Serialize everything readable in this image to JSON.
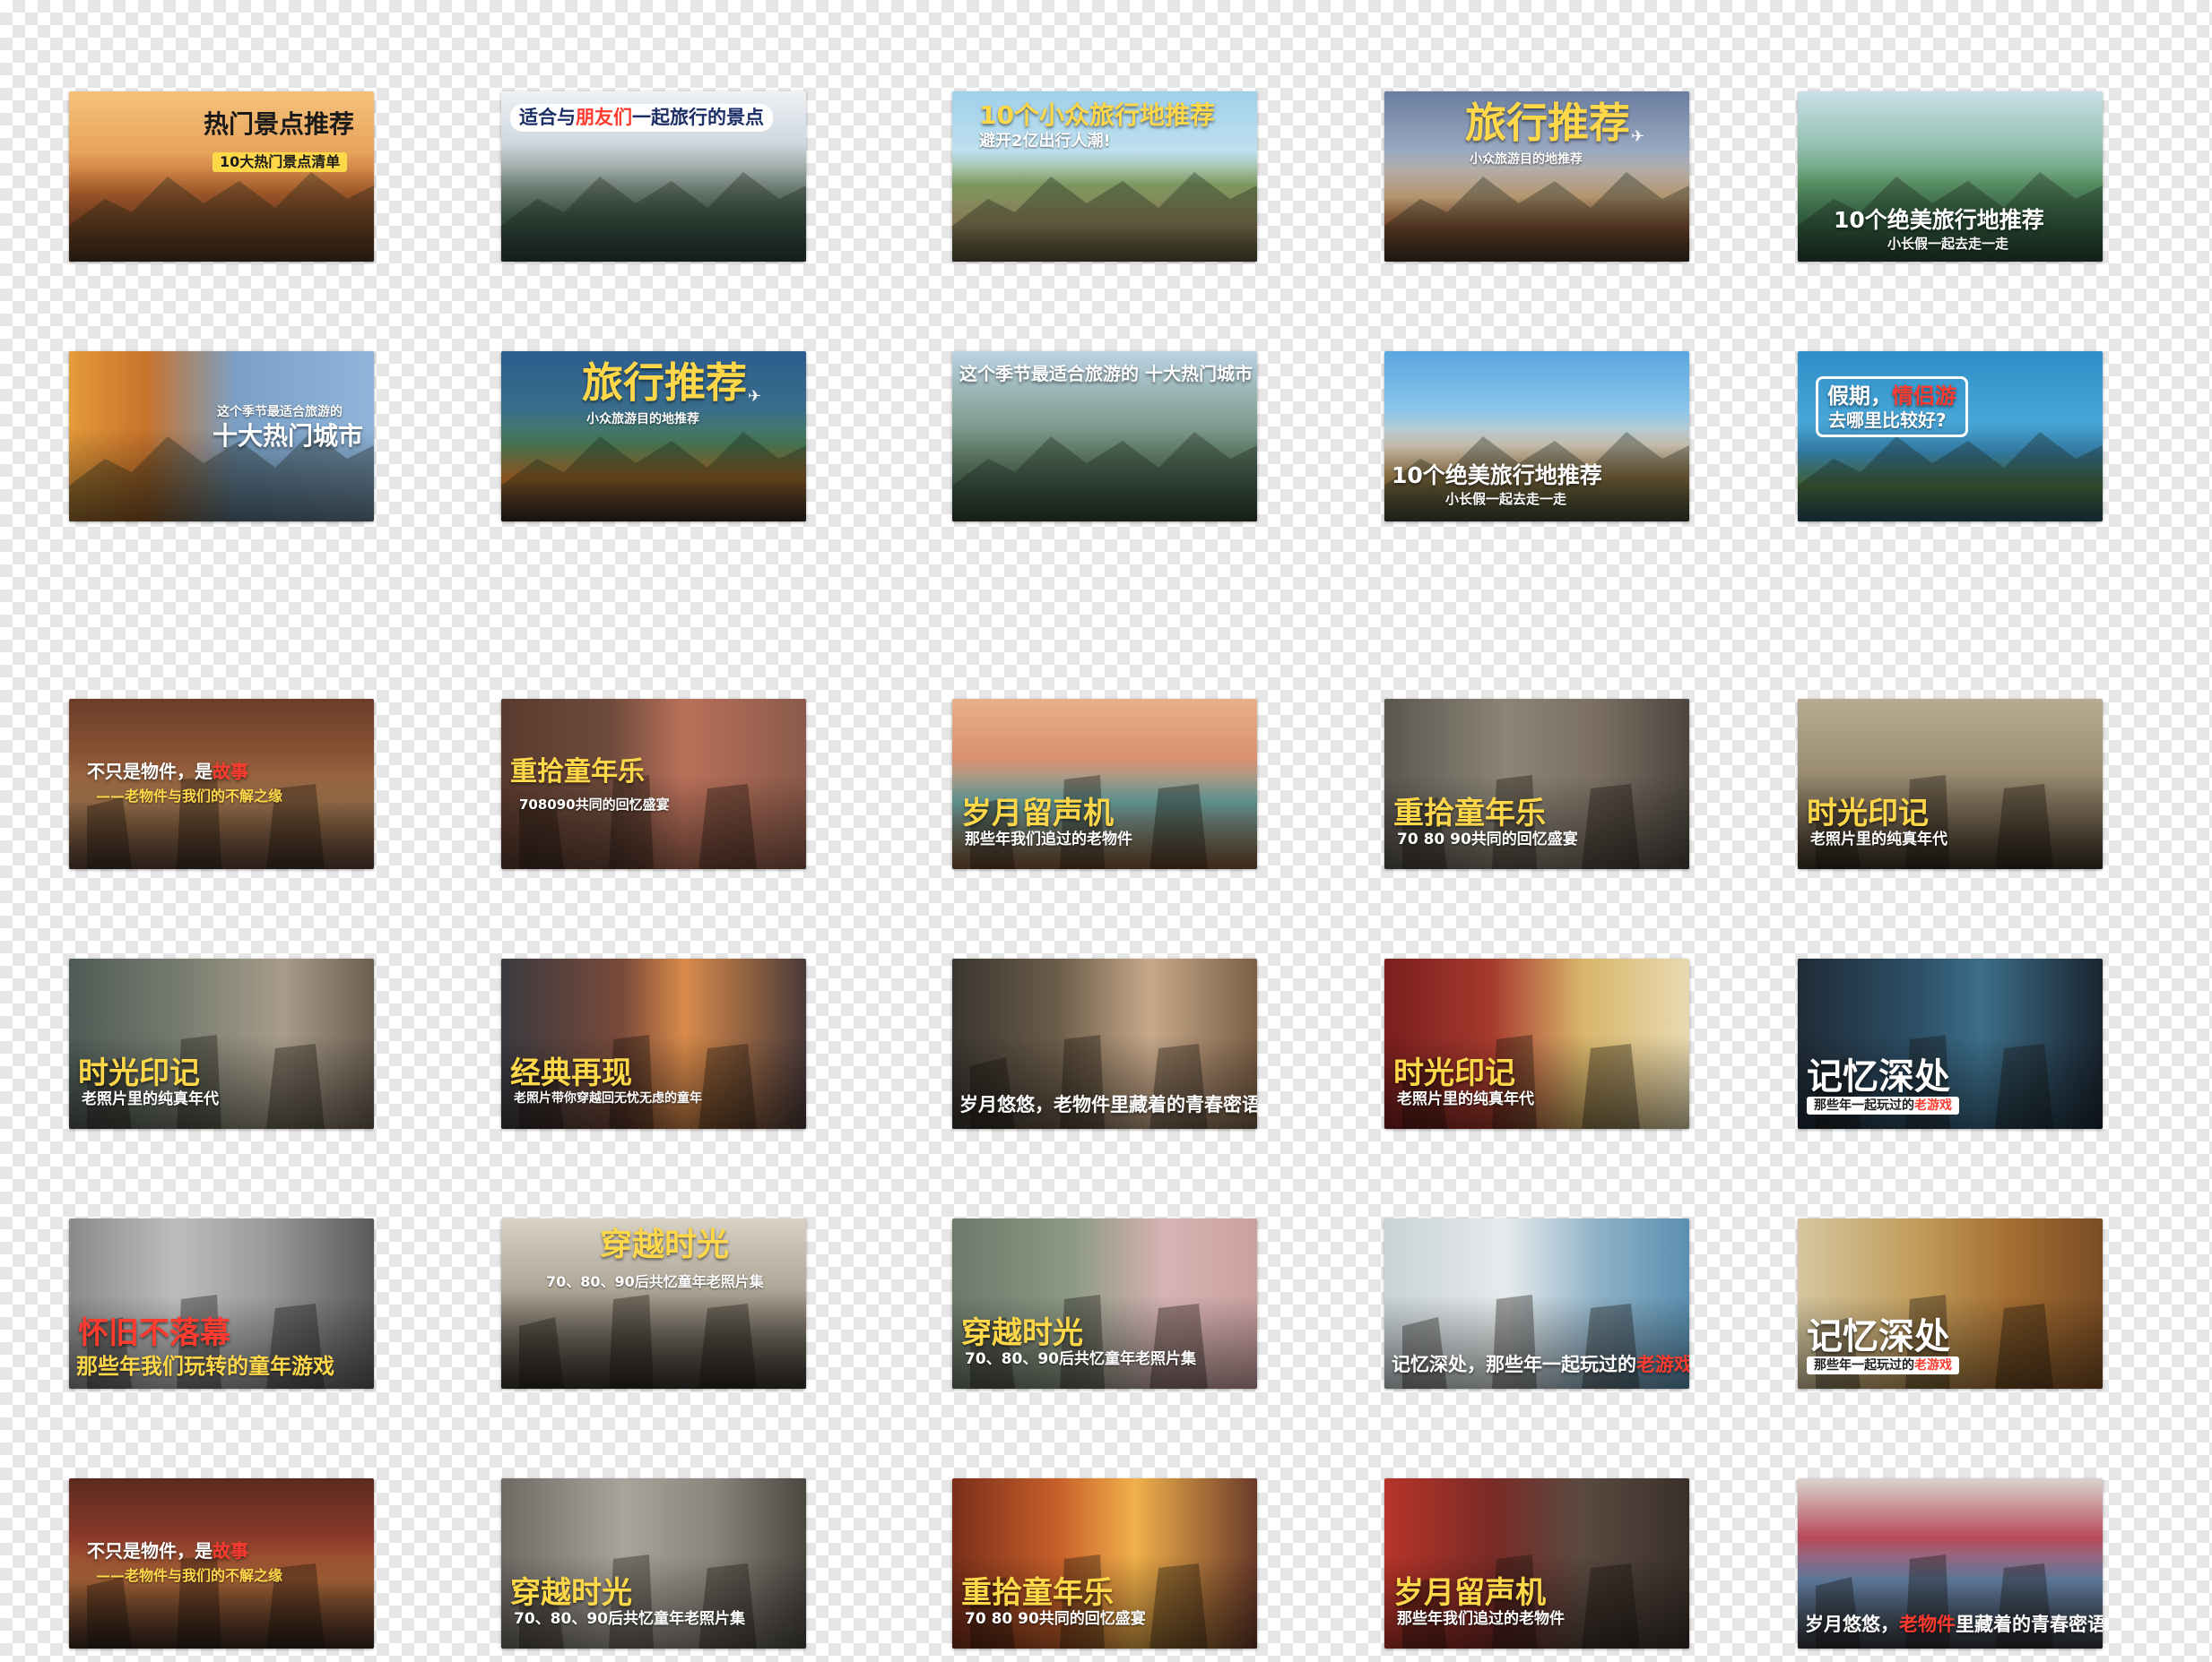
{
  "colors": {
    "checker": "#e6e6e6",
    "yellow_text": "#ffd84a",
    "white_text": "#ffffff",
    "highlight_red": "#ff3b2f",
    "travel_navy": "#1b2e66",
    "nostalgia_brown": "#4a3323"
  },
  "thumbnails": [
    {
      "theme": "travel",
      "scene": "potala-palace",
      "title": "热门景点推荐",
      "subtitle": "10大热门景点清单",
      "title_color": "#1a1a1a",
      "subtitle_style": "tag-yellow"
    },
    {
      "theme": "travel",
      "scene": "water-town",
      "title": "适合与朋友们一起旅行的景点",
      "title_hl": "朋友们",
      "title_color": "#1b2e66",
      "subtitle": "",
      "subtitle_style": "none"
    },
    {
      "theme": "travel",
      "scene": "stone-bridge",
      "title": "10个小众旅行地推荐",
      "subtitle": "避开2亿出行人潮!",
      "title_color": "#ffd84a",
      "subtitle_style": "white"
    },
    {
      "theme": "travel",
      "scene": "monastery",
      "title": "旅行推荐",
      "subtitle": "小众旅游目的地推荐",
      "title_color": "#ffd84a",
      "subtitle_style": "white-small"
    },
    {
      "theme": "travel",
      "scene": "green-mountain",
      "title": "10个绝美旅行地推荐",
      "subtitle": "小长假一起去走一走",
      "title_color": "#ffffff",
      "subtitle_style": "white-small"
    },
    {
      "theme": "travel",
      "scene": "pavilion-sunset",
      "title": "十大热门城市",
      "subtitle": "这个季节最适合旅游的",
      "title_color": "#ffffff",
      "subtitle_style": "white-small"
    },
    {
      "theme": "travel",
      "scene": "night-bridge",
      "title": "旅行推荐",
      "subtitle": "小众旅游目的地推荐",
      "title_color": "#ffd84a",
      "subtitle_style": "white-small"
    },
    {
      "theme": "travel",
      "scene": "karst-peaks",
      "title": "这个季节最适合旅游的 十大热门城市",
      "subtitle": "",
      "title_color": "#ffffff",
      "subtitle_style": "none"
    },
    {
      "theme": "travel",
      "scene": "pagodas",
      "title": "10个绝美旅行地推荐",
      "subtitle": "小长假一起去走一走",
      "title_color": "#ffffff",
      "subtitle_style": "white-small"
    },
    {
      "theme": "travel",
      "scene": "island-lake",
      "title": "假期，情侣游",
      "title_hl": "情侣游",
      "subtitle": "去哪里比较好?",
      "title_color": "#ffffff",
      "subtitle_style": "white"
    },
    {
      "theme": "nostalgia",
      "scene": "old-shop-bike",
      "title": "不只是物件，是故事",
      "title_hl": "故事",
      "subtitle": "——老物件与我们的不解之缘",
      "title_color": "#ffffff",
      "subtitle_style": "yellow-small"
    },
    {
      "theme": "nostalgia",
      "scene": "kids-playing",
      "title": "重拾童年乐",
      "subtitle": "708090共同的回忆盛宴",
      "title_color": "#ffd84a",
      "subtitle_style": "white-small"
    },
    {
      "theme": "nostalgia",
      "scene": "retro-room",
      "title": "岁月留声机",
      "subtitle": "那些年我们追过的老物件",
      "title_color": "#ffd84a",
      "subtitle_style": "white-small"
    },
    {
      "theme": "nostalgia",
      "scene": "kids-at-window",
      "title": "重拾童年乐",
      "subtitle": "70 80 90共同的回忆盛宴",
      "title_color": "#ffd84a",
      "subtitle_style": "white-small"
    },
    {
      "theme": "nostalgia",
      "scene": "classroom",
      "title": "时光印记",
      "subtitle": "老照片里的纯真年代",
      "title_color": "#ffd84a",
      "subtitle_style": "white-small"
    },
    {
      "theme": "nostalgia",
      "scene": "boy-studying",
      "title": "时光印记",
      "subtitle": "老照片里的纯真年代",
      "title_color": "#ffd84a",
      "subtitle_style": "white-small"
    },
    {
      "theme": "nostalgia",
      "scene": "jump-rope",
      "title": "经典再现",
      "subtitle": "老照片带你穿越回无忧无虑的童年",
      "title_color": "#ffd84a",
      "subtitle_style": "white-small"
    },
    {
      "theme": "nostalgia",
      "scene": "old-tv",
      "title": "岁月悠悠，老物件里藏着的青春密语",
      "subtitle": "",
      "title_color": "#ffffff",
      "subtitle_style": "none"
    },
    {
      "theme": "nostalgia",
      "scene": "red-cabinet",
      "title": "时光印记",
      "subtitle": "老照片里的纯真年代",
      "title_color": "#ffd84a",
      "subtitle_style": "white-small"
    },
    {
      "theme": "nostalgia",
      "scene": "arcade",
      "title": "记忆深处",
      "subtitle": "那些年一起玩过的老游戏",
      "subtitle_hl": "老游戏",
      "title_color": "#ffffff",
      "subtitle_style": "tag-white"
    },
    {
      "theme": "nostalgia",
      "scene": "bw-kids",
      "title": "怀旧不落幕",
      "subtitle": "那些年我们玩转的童年游戏",
      "title_color": "#ff3b2f",
      "subtitle_style": "yellow"
    },
    {
      "theme": "nostalgia",
      "scene": "street-crowd",
      "title": "穿越时光",
      "subtitle": "70、80、90后共忆童年老照片集",
      "title_color": "#ffd84a",
      "subtitle_style": "white-small"
    },
    {
      "theme": "nostalgia",
      "scene": "bedroom",
      "title": "穿越时光",
      "subtitle": "70、80、90后共忆童年老照片集",
      "title_color": "#ffd84a",
      "subtitle_style": "white-small"
    },
    {
      "theme": "nostalgia",
      "scene": "computer-lab",
      "title": "记忆深处，那些年一起玩过的老游戏",
      "title_hl": "老游戏",
      "subtitle": "",
      "title_color": "#ffffff",
      "subtitle_style": "none"
    },
    {
      "theme": "nostalgia",
      "scene": "game-console",
      "title": "记忆深处",
      "subtitle": "那些年一起玩过的老游戏",
      "subtitle_hl": "老游戏",
      "title_color": "#ffffff",
      "subtitle_style": "tag-white"
    },
    {
      "theme": "nostalgia",
      "scene": "toy-shelf",
      "title": "不只是物件，是故事",
      "title_hl": "故事",
      "subtitle": "——老物件与我们的不解之缘",
      "title_color": "#ffffff",
      "subtitle_style": "yellow-small"
    },
    {
      "theme": "nostalgia",
      "scene": "bw-hopscotch",
      "title": "穿越时光",
      "subtitle": "70、80、90后共忆童年老照片集",
      "title_color": "#ffd84a",
      "subtitle_style": "white-small"
    },
    {
      "theme": "nostalgia",
      "scene": "sunset-kids",
      "title": "重拾童年乐",
      "subtitle": "70 80 90共同的回忆盛宴",
      "title_color": "#ffd84a",
      "subtitle_style": "white-small"
    },
    {
      "theme": "nostalgia",
      "scene": "thermos-radio",
      "title": "岁月留声机",
      "subtitle": "那些年我们追过的老物件",
      "title_color": "#ffd84a",
      "subtitle_style": "white-small"
    },
    {
      "theme": "nostalgia",
      "scene": "cassettes",
      "title": "岁月悠悠，老物件里藏着的青春密语",
      "title_hl": "老物件",
      "subtitle": "",
      "title_color": "#ffffff",
      "subtitle_style": "none"
    }
  ]
}
